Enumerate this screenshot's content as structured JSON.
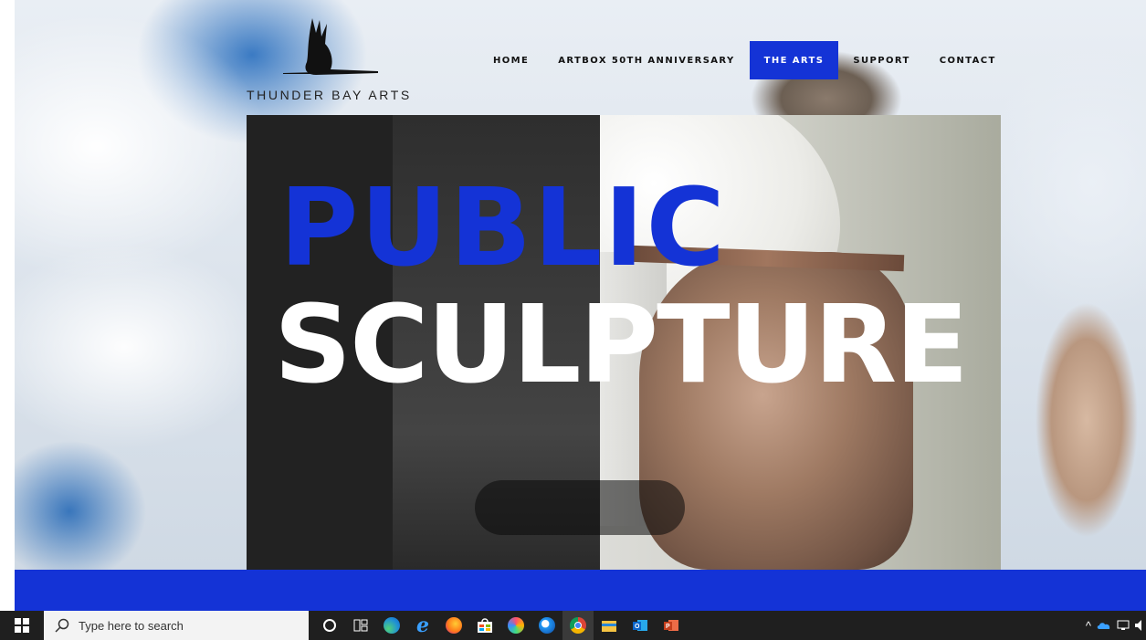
{
  "site": {
    "logo_text": "THUNDER BAY ARTS"
  },
  "nav": {
    "items": [
      {
        "label": "HOME",
        "active": false
      },
      {
        "label": "ARTBOX 50TH ANNIVERSARY",
        "active": false
      },
      {
        "label": "THE ARTS",
        "active": true
      },
      {
        "label": "SUPPORT",
        "active": false
      },
      {
        "label": "CONTACT",
        "active": false
      }
    ]
  },
  "hero": {
    "title_line1": "PUBLIC",
    "title_line2": "SCULPTURE"
  },
  "colors": {
    "accent": "#1433d6",
    "dark_panel": "#222222"
  },
  "taskbar": {
    "search_placeholder": "Type here to search",
    "icons": [
      {
        "name": "cortana-icon"
      },
      {
        "name": "task-view-icon"
      },
      {
        "name": "edge-icon"
      },
      {
        "name": "internet-explorer-icon"
      },
      {
        "name": "firefox-icon"
      },
      {
        "name": "store-icon"
      },
      {
        "name": "app-circle-icon"
      },
      {
        "name": "app-circle-blue-icon"
      },
      {
        "name": "chrome-icon",
        "active": true
      },
      {
        "name": "file-explorer-icon"
      },
      {
        "name": "outlook-icon"
      },
      {
        "name": "powerpoint-icon"
      }
    ]
  }
}
